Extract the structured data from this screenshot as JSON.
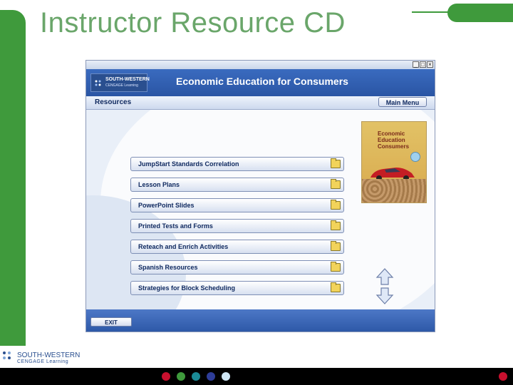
{
  "slide": {
    "title": "Instructor Resource CD"
  },
  "app": {
    "brand_name": "SOUTH-WESTERN",
    "brand_sub": "CENGAGE Learning",
    "title": "Economic Education for Consumers",
    "section": "Resources",
    "main_menu_label": "Main Menu",
    "exit_label": "EXIT",
    "window_controls": [
      "_",
      "□",
      "×"
    ]
  },
  "book": {
    "title_lines": [
      "Economic",
      "Education",
      "Consumers"
    ]
  },
  "resources": [
    {
      "label": "JumpStart Standards Correlation"
    },
    {
      "label": "Lesson Plans"
    },
    {
      "label": "PowerPoint Slides"
    },
    {
      "label": "Printed Tests and Forms"
    },
    {
      "label": "Reteach and Enrich Activities"
    },
    {
      "label": "Spanish Resources"
    },
    {
      "label": "Strategies for Block Scheduling"
    }
  ],
  "footer": {
    "brand_name": "SOUTH-WESTERN",
    "brand_sub": "CENGAGE Learning"
  },
  "colors": {
    "accent_green": "#3f9a3c",
    "header_blue": "#2a55a4",
    "dot_colors": [
      "#c8102e",
      "#3f9a3c",
      "#1b8a96",
      "#2e3d98",
      "#cfe6f5"
    ]
  }
}
